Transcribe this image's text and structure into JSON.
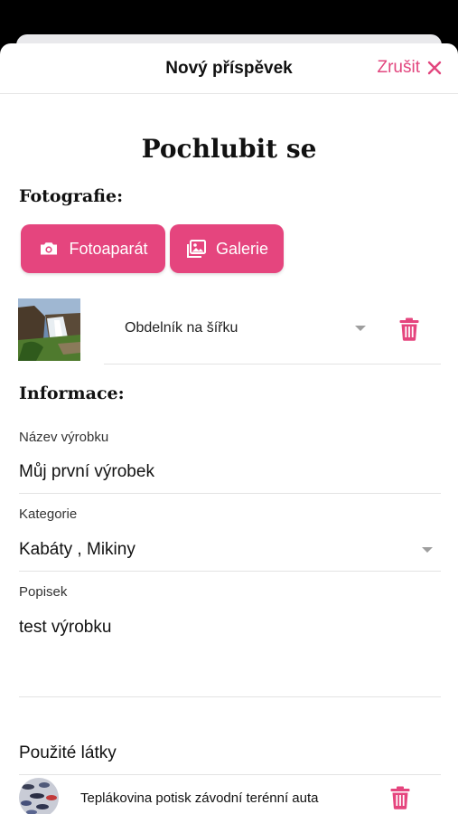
{
  "navbar": {
    "title": "Nový příspěvek",
    "cancel_label": "Zrušit",
    "cancel_icon": "close-icon"
  },
  "page": {
    "title": "Pochlubit se"
  },
  "photos_section": {
    "title": "Fotografie:",
    "camera_button": "Fotoaparát",
    "gallery_button": "Galerie",
    "photo_item": {
      "shape_select_value": "Obdelník na šířku"
    }
  },
  "info_section": {
    "title": "Informace:",
    "fields": [
      {
        "label": "Název výrobku",
        "value": "Můj první výrobek"
      },
      {
        "label": "Kategorie",
        "value": "Kabáty , Mikiny"
      },
      {
        "label": "Popisek",
        "value": "test výrobku"
      }
    ]
  },
  "materials_section": {
    "title": "Použité látky",
    "items": [
      {
        "name": "Teplákovina potisk závodní terénní auta"
      }
    ]
  },
  "colors": {
    "accent": "#e5457e",
    "divider": "#e3e3e3"
  }
}
